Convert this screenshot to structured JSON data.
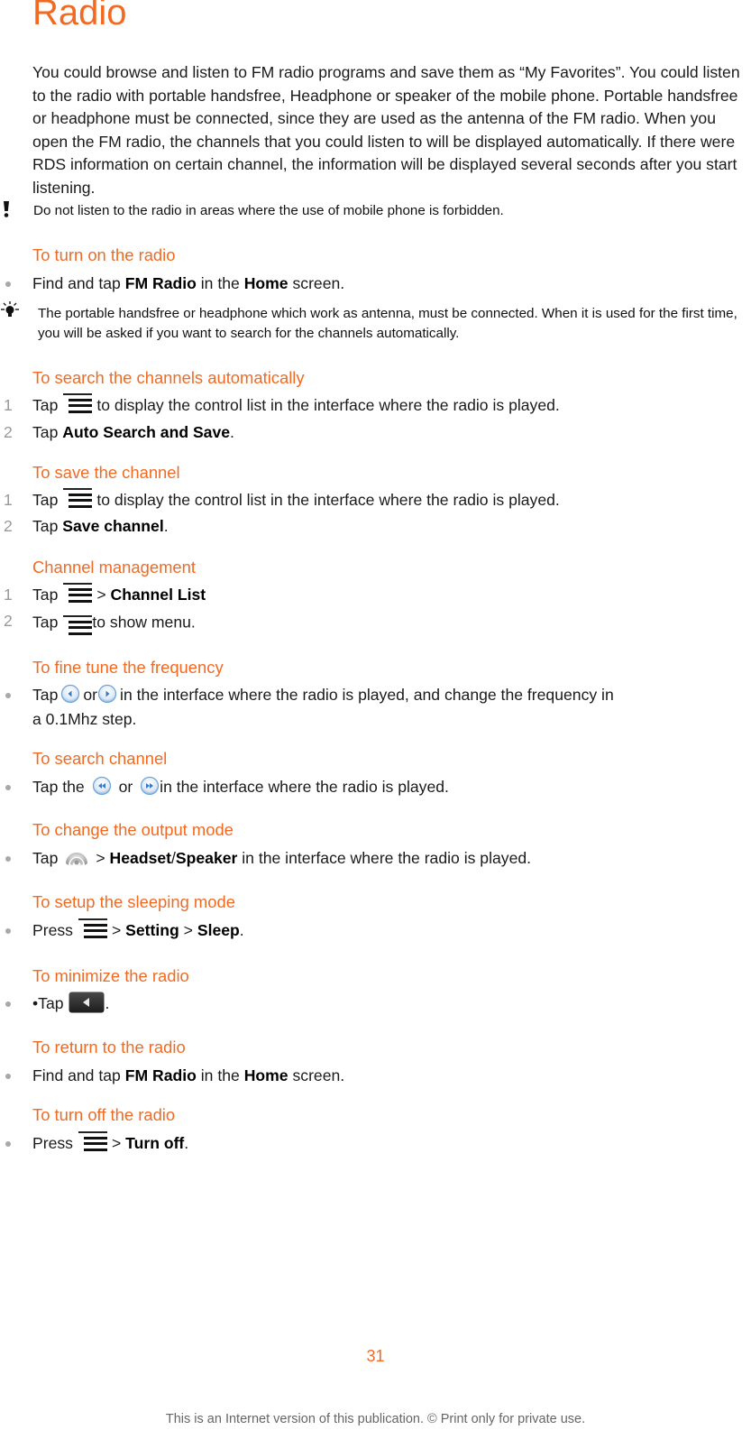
{
  "title": "Radio",
  "intro": "You could browse and listen to FM radio programs and save them as “My Favorites”. You could listen to the radio with portable handsfree, Headphone or speaker of the mobile phone. Portable handsfree or headphone must be connected, since they are used as the antenna of the FM radio. When you open the FM radio, the channels that you could listen to will be displayed automatically. If there were RDS information on certain channel, the information will be displayed several seconds after you start listening.",
  "warning_note": "Do not listen to the radio in areas where the use of mobile phone is forbidden.",
  "tip_note": "The portable handsfree or headphone which work as antenna, must be connected. When it is used for the first time, you will be asked if you want to search for the channels automatically.",
  "sections": {
    "turn_on": {
      "heading": "To turn on the radio",
      "steps": [
        {
          "pre": "Find and tap ",
          "b1": "FM Radio",
          "mid": " in the ",
          "b2": "Home",
          "post": " screen."
        }
      ]
    },
    "search_auto": {
      "heading": "To search the channels automatically",
      "steps": [
        {
          "num": "1",
          "pre": "Tap",
          "post": "to display the control list in the interface where the radio is played."
        },
        {
          "num": "2",
          "pre": "Tap ",
          "b1": "Auto Search and Save",
          "post": "."
        }
      ]
    },
    "save_channel": {
      "heading": "To save the channel",
      "steps": [
        {
          "num": "1",
          "pre": "Tap",
          "post": "to display the control list in the interface where the radio is played."
        },
        {
          "num": "2",
          "pre": "Tap ",
          "b1": "Save channel",
          "post": "."
        }
      ]
    },
    "channel_mgmt": {
      "heading": "Channel management",
      "steps": [
        {
          "num": "1",
          "pre": "Tap",
          "sep": "> ",
          "b1": "Channel List"
        },
        {
          "num": "2",
          "pre": "Tap",
          "post": "to show menu."
        }
      ]
    },
    "fine_tune": {
      "heading": "To fine tune the frequency",
      "steps": [
        {
          "pre": "Tap",
          "or": "or",
          "post": "in the interface where the radio is played, and change the frequency in",
          "post2": "a 0.1Mhz step."
        }
      ]
    },
    "search_channel": {
      "heading": "To search channel",
      "steps": [
        {
          "pre": "Tap the",
          "or": "or",
          "post": "in the interface where the radio is played."
        }
      ]
    },
    "output_mode": {
      "heading": "To change the output mode",
      "steps": [
        {
          "pre": "Tap",
          "sep": "> ",
          "b1": "Headset",
          "slash": "/",
          "b2": "Speaker",
          "post": " in the interface where the radio is played."
        }
      ]
    },
    "sleep_mode": {
      "heading": "To setup the sleeping mode",
      "steps": [
        {
          "pre": "Press",
          "sep": "> ",
          "b1": "Setting",
          "sep2": " > ",
          "b2": "Sleep",
          "post": "."
        }
      ]
    },
    "minimize": {
      "heading": "To minimize the radio",
      "steps": [
        {
          "pre": "•Tap",
          "post": "."
        }
      ]
    },
    "return": {
      "heading": "To return to the radio",
      "steps": [
        {
          "pre": "Find and tap ",
          "b1": "FM Radio",
          "mid": " in the ",
          "b2": "Home",
          "post": " screen."
        }
      ]
    },
    "turn_off": {
      "heading": "To turn off the radio",
      "steps": [
        {
          "pre": "Press",
          "sep": "> ",
          "b1": "Turn off",
          "post": "."
        }
      ]
    }
  },
  "icons": {
    "menu": "menu-icon",
    "prev": "arrow-left-circle-icon",
    "next": "arrow-right-circle-icon",
    "rewind": "rewind-circle-icon",
    "forward": "fast-forward-circle-icon",
    "output": "headset-speaker-icon",
    "back": "back-button-icon",
    "warning": "exclamation-icon",
    "tip": "lightbulb-icon"
  },
  "colors": {
    "accent": "#f26a21",
    "text": "#1a1a1a",
    "muted": "#999999"
  },
  "page_number": "31",
  "footer": "This is an Internet version of this publication. © Print only for private use."
}
